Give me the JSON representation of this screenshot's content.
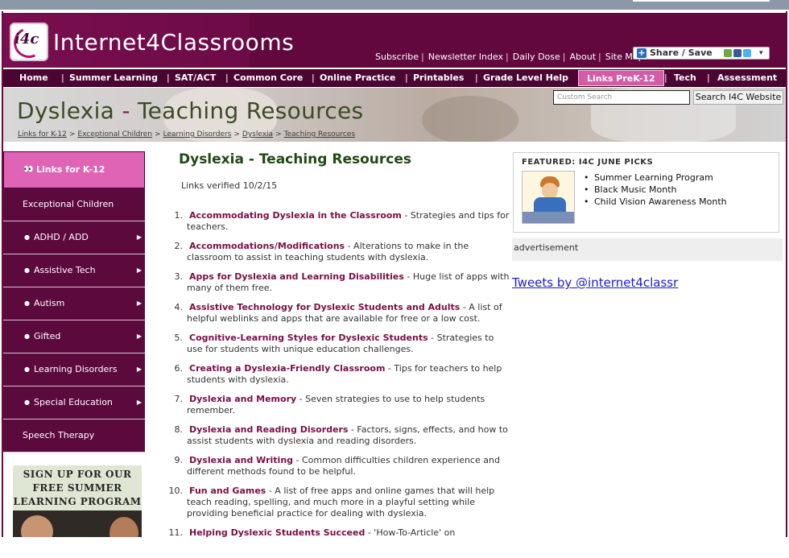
{
  "site": {
    "name": "Internet4Classrooms",
    "logo_text": "i4c"
  },
  "top_links": [
    "Subscribe",
    "Newsletter Index",
    "Daily Dose",
    "About",
    "Site Map"
  ],
  "share": {
    "label": "Share / Save"
  },
  "nav": {
    "items": [
      "Home",
      "Summer Learning",
      "SAT/ACT",
      "Common Core",
      "Online Practice",
      "Printables",
      "Grade Level Help",
      "Links PreK-12",
      "Tech",
      "Assessment"
    ],
    "active": "Links PreK-12"
  },
  "hero": {
    "title_part1": "Dyslexia",
    "title_dash": " - ",
    "title_part2": "Teaching Resources"
  },
  "breadcrumb": [
    "Links for K-12",
    "Exceptional Children",
    "Learning Disorders",
    "Dyslexia",
    "Teaching Resources"
  ],
  "search": {
    "placeholder": "Custom Search",
    "button": "Search I4C Website"
  },
  "sidebar": {
    "items": [
      {
        "label": "Links for K-12",
        "type": "active"
      },
      {
        "label": "Exceptional Children",
        "type": "plain"
      },
      {
        "label": "ADHD / ADD",
        "type": "sub"
      },
      {
        "label": "Assistive Tech",
        "type": "sub"
      },
      {
        "label": "Autism",
        "type": "sub"
      },
      {
        "label": "Gifted",
        "type": "sub"
      },
      {
        "label": "Learning Disorders",
        "type": "sub"
      },
      {
        "label": "Special Education",
        "type": "sub"
      },
      {
        "label": "Speech Therapy",
        "type": "plain"
      }
    ],
    "promo_lines": [
      "SIGN UP FOR OUR",
      "FREE SUMMER",
      "LEARNING PROGRAM"
    ]
  },
  "main": {
    "title": "Dyslexia - Teaching Resources",
    "verified": "Links verified 10/2/15",
    "resources": [
      {
        "n": "1.",
        "title": "Accommodating Dyslexia in the Classroom",
        "desc": " - Strategies and tips for teachers."
      },
      {
        "n": "2.",
        "title": "Accommodations/Modifications",
        "desc": " - Alterations to make in the classroom to assist in teaching students with dyslexia."
      },
      {
        "n": "3.",
        "title": "Apps for Dyslexia and Learning Disabilities",
        "desc": " - Huge list of apps with many of them free."
      },
      {
        "n": "4.",
        "title": "Assistive Technology for Dyslexic Students and Adults",
        "desc": " - A list of helpful weblinks and apps that are available for free or a low cost."
      },
      {
        "n": "5.",
        "title": "Cognitive-Learning Styles for Dyslexic Students",
        "desc": " - Strategies to use for students with unique education challenges."
      },
      {
        "n": "6.",
        "title": "Creating a Dyslexia-Friendly Classroom",
        "desc": " - Tips for teachers to help students with dyslexia."
      },
      {
        "n": "7.",
        "title": "Dyslexia and Memory",
        "desc": " - Seven strategies to use to help students remember."
      },
      {
        "n": "8.",
        "title": "Dyslexia and Reading Disorders",
        "desc": " - Factors, signs, effects, and how to assist students with dyslexia and reading disorders."
      },
      {
        "n": "9.",
        "title": "Dyslexia and Writing",
        "desc": " - Common difficulties children experience and different methods found to be helpful."
      },
      {
        "n": "10.",
        "title": "Fun and Games",
        "desc": " - A list of free apps and online games that will help teach reading, spelling, and much more in a playful setting while providing beneficial practice for dealing with dyslexia."
      },
      {
        "n": "11.",
        "title": "Helping Dyslexic Students Succeed",
        "desc": " - 'How-To-Article' on"
      }
    ]
  },
  "featured": {
    "heading": "FEATURED: I4C JUNE PICKS",
    "items": [
      "Summer Learning Program",
      "Black Music Month",
      "Child Vision Awareness Month"
    ]
  },
  "advertisement_label": "advertisement",
  "tweets_label": "Tweets by @internet4classr"
}
